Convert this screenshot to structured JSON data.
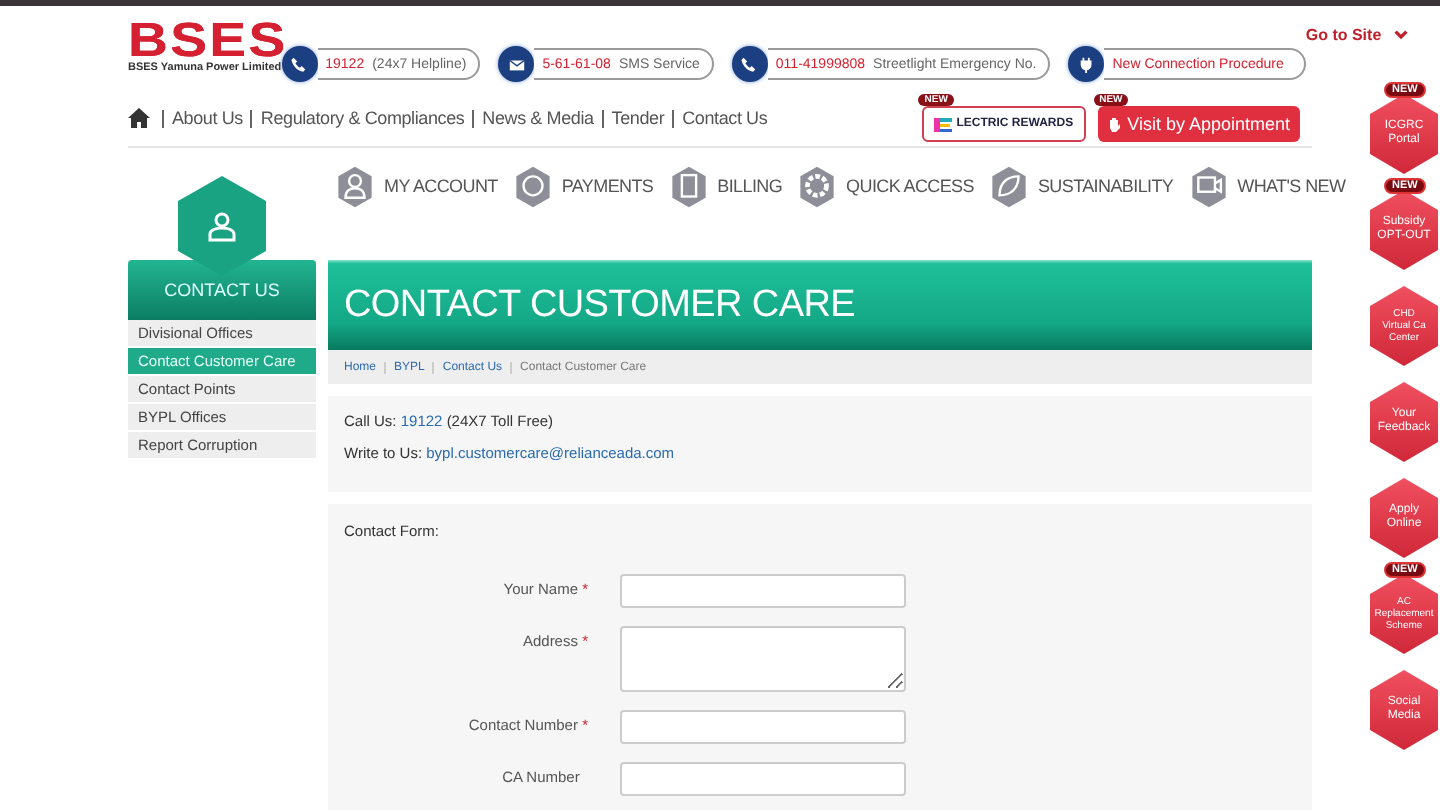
{
  "header": {
    "logo": "BSES",
    "tagline": "BSES Yamuna Power Limited",
    "go_to_site": "Go to Site",
    "contacts": [
      {
        "kind": "phone",
        "number": "19122",
        "label": "(24x7 Helpline)"
      },
      {
        "kind": "mail",
        "number": "5-61-61-08",
        "label": "SMS Service"
      },
      {
        "kind": "phone",
        "number": "011-41999808",
        "label": "Streetlight Emergency No."
      },
      {
        "kind": "plug",
        "number": "New Connection Procedure"
      }
    ]
  },
  "nav": {
    "links": [
      "About Us",
      "Regulatory & Compliances",
      "News & Media",
      "Tender",
      "Contact Us"
    ],
    "rewards": {
      "badge": "NEW",
      "text": "LECTRIC REWARDS"
    },
    "appointment": {
      "badge": "NEW",
      "text": "Visit by Appointment"
    }
  },
  "menu": [
    "MY ACCOUNT",
    "PAYMENTS",
    "BILLING",
    "QUICK ACCESS",
    "SUSTAINABILITY",
    "WHAT'S NEW"
  ],
  "sidebar": {
    "title": "CONTACT US",
    "items": [
      {
        "label": "Divisional Offices",
        "selected": false
      },
      {
        "label": "Contact Customer Care",
        "selected": true
      },
      {
        "label": "Contact Points",
        "selected": false
      },
      {
        "label": "BYPL Offices",
        "selected": false
      },
      {
        "label": "Report Corruption",
        "selected": false
      }
    ]
  },
  "page_title": "CONTACT CUSTOMER CARE",
  "breadcrumb": [
    "Home",
    "BYPL",
    "Contact Us",
    "Contact Customer Care"
  ],
  "contact_info": {
    "call_label": "Call Us:",
    "call_number": "19122",
    "call_note": "(24X7 Toll Free)",
    "write_label": "Write to Us:",
    "email": "bypl.customercare@relianceada.com"
  },
  "form": {
    "title": "Contact Form:",
    "required_mark": "*",
    "fields": [
      {
        "label": "Your Name",
        "required": true,
        "kind": "text"
      },
      {
        "label": "Address",
        "required": true,
        "kind": "textarea"
      },
      {
        "label": "Contact Number",
        "required": true,
        "kind": "text"
      },
      {
        "label": "CA Number",
        "required": false,
        "kind": "text"
      }
    ]
  },
  "rail": [
    {
      "lines": [
        "ICGRC",
        "Portal"
      ],
      "badge": "NEW"
    },
    {
      "lines": [
        "Subsidy",
        "OPT-OUT"
      ],
      "badge": "NEW"
    },
    {
      "lines": [
        "CHD",
        "Virtual Ca",
        "Center"
      ]
    },
    {
      "lines": [
        "Your",
        "Feedback"
      ]
    },
    {
      "lines": [
        "Apply",
        "Online"
      ]
    },
    {
      "lines": [
        "AC",
        "Replacement",
        "Scheme"
      ],
      "badge": "NEW"
    },
    {
      "lines": [
        "Social",
        "Media"
      ]
    }
  ]
}
